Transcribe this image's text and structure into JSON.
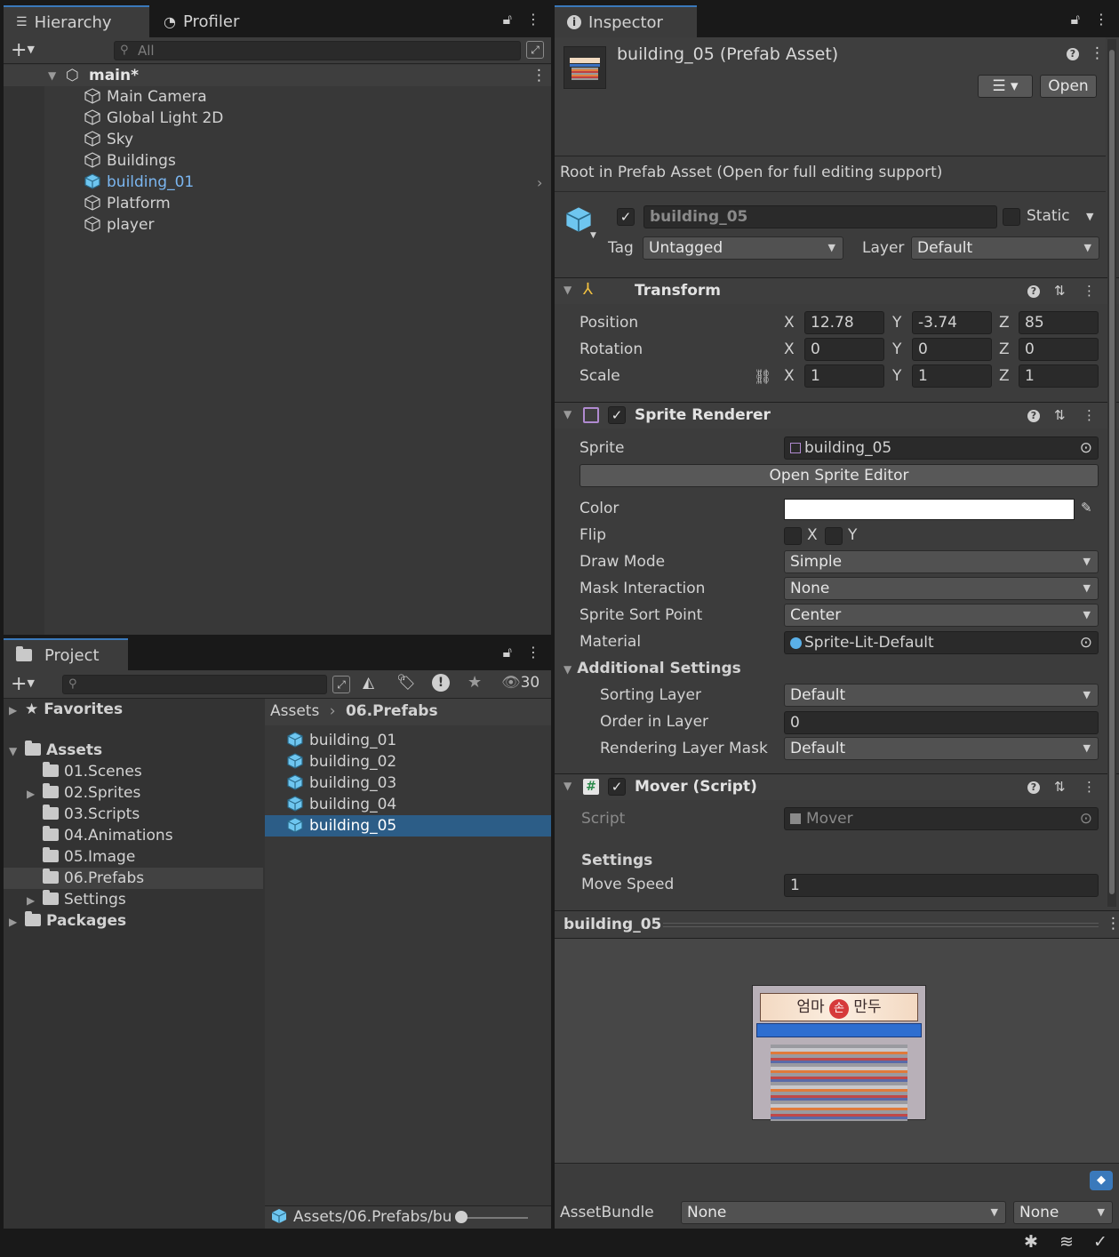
{
  "hierarchy": {
    "tab_label": "Hierarchy",
    "profiler_tab_label": "Profiler",
    "search_placeholder": "All",
    "scene_name": "main*",
    "items": [
      {
        "label": "Main Camera"
      },
      {
        "label": "Global Light 2D"
      },
      {
        "label": "Sky"
      },
      {
        "label": "Buildings"
      },
      {
        "label": "building_01"
      },
      {
        "label": "Platform"
      },
      {
        "label": "player"
      }
    ]
  },
  "project": {
    "tab_label": "Project",
    "hidden_count": "30",
    "tree": {
      "favorites": "Favorites",
      "assets": "Assets",
      "folders": [
        "01.Scenes",
        "02.Sprites",
        "03.Scripts",
        "04.Animations",
        "05.Image",
        "06.Prefabs",
        "Settings"
      ],
      "packages": "Packages"
    },
    "breadcrumb": {
      "root": "Assets",
      "current": "06.Prefabs"
    },
    "files": [
      "building_01",
      "building_02",
      "building_03",
      "building_04",
      "building_05"
    ],
    "status_path": "Assets/06.Prefabs/bu"
  },
  "inspector": {
    "tab_label": "Inspector",
    "asset_title": "building_05 (Prefab Asset)",
    "open_label": "Open",
    "root_notice": "Root in Prefab Asset (Open for full editing support)",
    "object_name": "building_05",
    "static_label": "Static",
    "tag_label": "Tag",
    "tag_value": "Untagged",
    "layer_label": "Layer",
    "layer_value": "Default",
    "transform": {
      "title": "Transform",
      "position_label": "Position",
      "rotation_label": "Rotation",
      "scale_label": "Scale",
      "x": "X",
      "y": "Y",
      "z": "Z",
      "position": [
        "12.78",
        "-3.74",
        "85"
      ],
      "rotation": [
        "0",
        "0",
        "0"
      ],
      "scale": [
        "1",
        "1",
        "1"
      ]
    },
    "sprite_renderer": {
      "title": "Sprite Renderer",
      "sprite_label": "Sprite",
      "sprite_value": "building_05",
      "open_editor_label": "Open Sprite Editor",
      "color_label": "Color",
      "color_value": "#ffffff",
      "flip_label": "Flip",
      "flip_x": "X",
      "flip_y": "Y",
      "draw_mode_label": "Draw Mode",
      "draw_mode_value": "Simple",
      "mask_label": "Mask Interaction",
      "mask_value": "None",
      "sort_point_label": "Sprite Sort Point",
      "sort_point_value": "Center",
      "material_label": "Material",
      "material_value": "Sprite-Lit-Default",
      "additional_label": "Additional Settings",
      "sorting_layer_label": "Sorting Layer",
      "sorting_layer_value": "Default",
      "order_label": "Order in Layer",
      "order_value": "0",
      "rendering_mask_label": "Rendering Layer Mask",
      "rendering_mask_value": "Default"
    },
    "mover": {
      "title": "Mover (Script)",
      "script_label": "Script",
      "script_value": "Mover",
      "settings_label": "Settings",
      "move_speed_label": "Move Speed",
      "move_speed_value": "1"
    },
    "preview": {
      "title": "building_05",
      "sign_text_left": "엄마",
      "sign_text_mid": "손",
      "sign_text_right": "만두"
    },
    "assetbundle": {
      "label": "AssetBundle",
      "value": "None",
      "variant": "None"
    }
  },
  "colors": {
    "selection": "#2c5d87",
    "accent_blue": "#7bb6f0",
    "prefab_cube": "#6ec6f0"
  }
}
